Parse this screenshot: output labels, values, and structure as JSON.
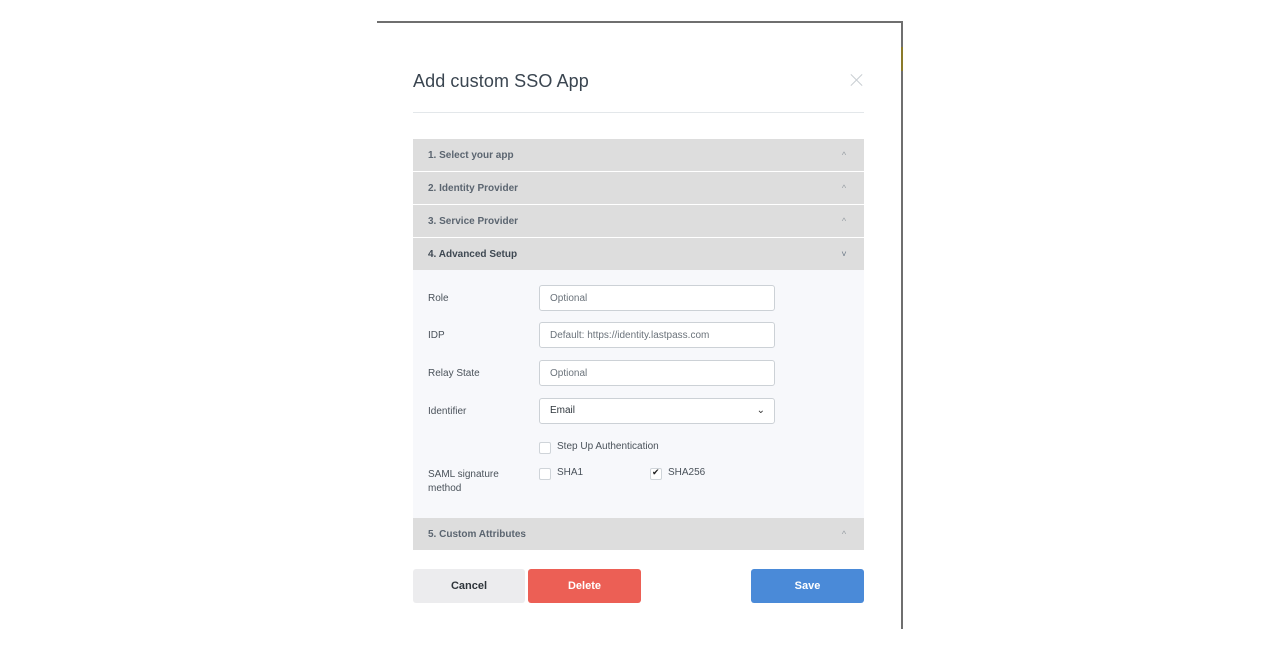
{
  "modal": {
    "title": "Add custom SSO App",
    "close_icon": "close-icon"
  },
  "accordion": {
    "sections": [
      {
        "label": "1. Select your app",
        "state": "collapsed",
        "icon": "chevron-up-icon"
      },
      {
        "label": "2. Identity Provider",
        "state": "collapsed",
        "icon": "chevron-up-icon"
      },
      {
        "label": "3. Service Provider",
        "state": "collapsed",
        "icon": "chevron-up-icon"
      },
      {
        "label": "4. Advanced Setup",
        "state": "expanded",
        "icon": "chevron-down-icon"
      },
      {
        "label": "5. Custom Attributes",
        "state": "collapsed",
        "icon": "chevron-up-icon"
      }
    ],
    "chevron_up": "^",
    "chevron_down": "˅"
  },
  "advanced_setup": {
    "role": {
      "label": "Role",
      "value": "",
      "placeholder": "Optional"
    },
    "idp": {
      "label": "IDP",
      "value": "",
      "placeholder": "Default: https://identity.lastpass.com"
    },
    "relay_state": {
      "label": "Relay State",
      "value": "",
      "placeholder": "Optional"
    },
    "identifier": {
      "label": "Identifier",
      "selected": "Email",
      "chevron": "⌄"
    },
    "step_up_auth": {
      "label": "Step Up Authentication",
      "checked": false
    },
    "saml_signature": {
      "label": "SAML signature method",
      "options": [
        {
          "label": "SHA1",
          "checked": false
        },
        {
          "label": "SHA256",
          "checked": true
        }
      ]
    }
  },
  "footer": {
    "cancel_label": "Cancel",
    "delete_label": "Delete",
    "save_label": "Save"
  },
  "colors": {
    "save": "#4a8ad8",
    "delete": "#ec5f55",
    "cancel": "#ececee",
    "accordion_header": "#dddddd"
  }
}
